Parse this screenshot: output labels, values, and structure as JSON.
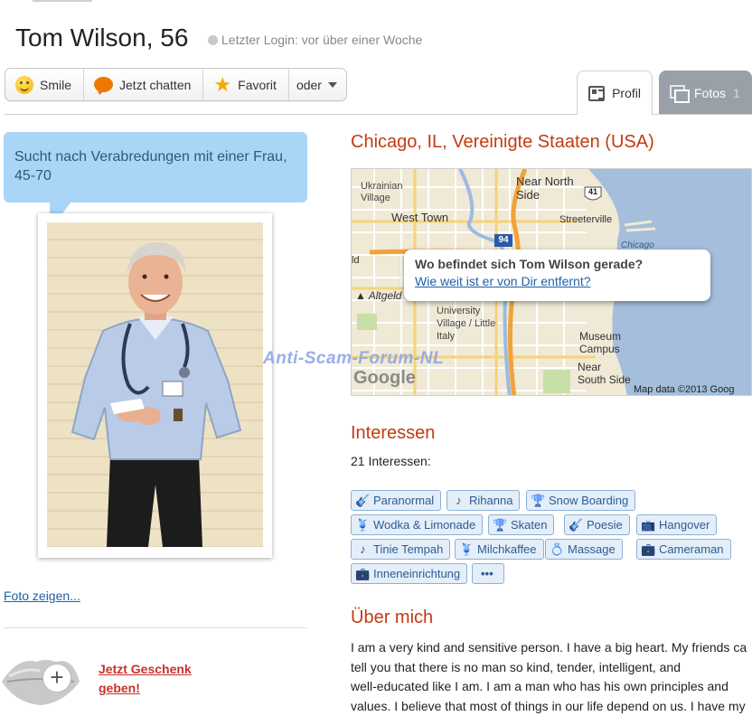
{
  "profile": {
    "name_age": "Tom Wilson, 56",
    "last_login": "Letzter Login: vor über einer Woche",
    "seeking": "Sucht nach Verabredungen mit einer Frau, 45-70",
    "show_photo_link": "Foto zeigen...",
    "gift_link": "Jetzt Geschenk geben!"
  },
  "actions": {
    "smile": "Smile",
    "chat": "Jetzt chatten",
    "favorite": "Favorit",
    "more": "oder"
  },
  "tabs": {
    "profile": "Profil",
    "photos": "Fotos",
    "photos_count": "1"
  },
  "location": {
    "title": "Chicago, IL, Vereinigte Staaten (USA)",
    "popup_question": "Wo befindet sich Tom Wilson gerade?",
    "popup_link": "Wie weit ist er von Dir entfernt?",
    "map_labels": {
      "ukrainian_village": "Ukrainian Village",
      "near_north_side": "Near North Side",
      "west_town": "West Town",
      "streeterville": "Streeterville",
      "chicago": "Chicago",
      "altgeld": "Altgeld",
      "university_village": "University Village / Little Italy",
      "museum_campus": "Museum Campus",
      "near_south_side": "Near South Side",
      "highway_41": "41",
      "highway_94": "94",
      "ld": "ld"
    },
    "map_credit": "Map data ©2013 Goog",
    "map_logo": "Google"
  },
  "watermark": "Anti-Scam-Forum-NL",
  "interests": {
    "title": "Interessen",
    "count": "21 Interessen:",
    "tags": [
      {
        "label": "Paranormal",
        "icon": "guitar-icon"
      },
      {
        "label": "Rihanna",
        "icon": "music-note-icon"
      },
      {
        "label": "Snow Boarding",
        "icon": "trophy-icon"
      },
      {
        "label": "Wodka & Limonade",
        "icon": "drinks-icon"
      },
      {
        "label": "Skaten",
        "icon": "trophy-icon"
      },
      {
        "label": "Poesie",
        "icon": "guitar-icon"
      },
      {
        "label": "Hangover",
        "icon": "tv-icon"
      },
      {
        "label": "Tinie Tempah",
        "icon": "music-note-icon"
      },
      {
        "label": "Milchkaffee",
        "icon": "drinks-icon"
      },
      {
        "label": "Massage",
        "icon": "ring-icon"
      },
      {
        "label": "Cameraman",
        "icon": "briefcase-icon"
      },
      {
        "label": "Inneneinrichtung",
        "icon": "briefcase-icon"
      },
      {
        "label": "•••",
        "icon": ""
      }
    ]
  },
  "about": {
    "title": "Über mich",
    "lines": [
      "I am a very kind and sensitive person. I have a big heart. My friends ca",
      "tell you that there is no man so kind, tender, intelligent, and",
      "well-educated like I am. I am a man who has his own principles and",
      "values. I believe that most of things in our life depend on us. I have my"
    ]
  },
  "colors": {
    "accent_red": "#c23b12",
    "link_blue": "#1f5fa8",
    "bubble_blue": "#a9d6f7",
    "tag_bg": "#e4eef9",
    "tab_inactive": "#9aa0a7"
  }
}
